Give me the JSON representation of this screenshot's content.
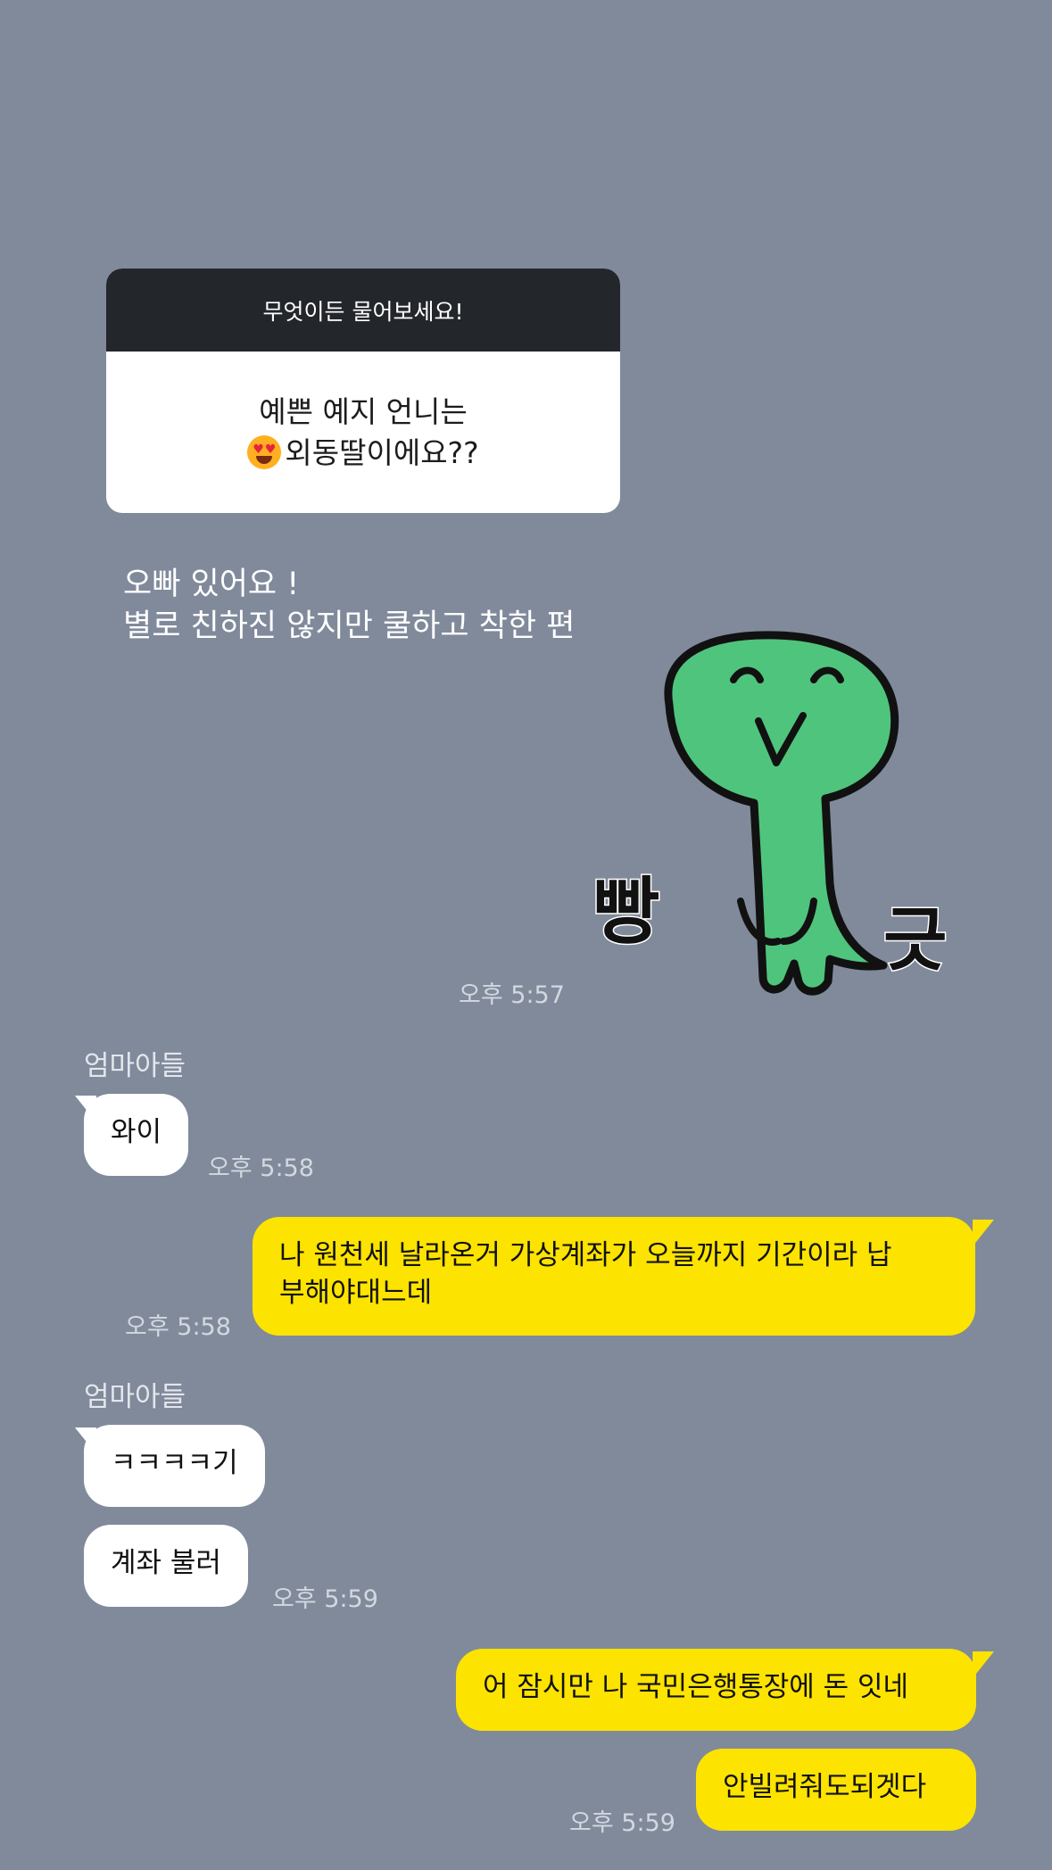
{
  "question_card": {
    "header": "무엇이든 물어보세요!",
    "line1": "예쁜 예지 언니는",
    "line2": "외동딸이에요??",
    "emoji": "heart-eyes-emoji"
  },
  "answer": {
    "line1": "오빠 있어요 !",
    "line2": "별로 친하진 않지만 쿨하고 착한 편"
  },
  "sticker": {
    "icon": "green-character-sticker",
    "text_left": "빵",
    "text_right": "긋",
    "color": "#4fc47d"
  },
  "messages": [
    {
      "time": "오후 5:57"
    },
    {
      "sender": "엄마아들",
      "text": "와이",
      "time": "오후 5:58"
    },
    {
      "line1": "나 원천세 날라온거 가상계좌가 오늘까지 기간이라 납",
      "line2": "부해야대느데",
      "time": "오후 5:58"
    },
    {
      "sender": "엄마아들",
      "text": "ㅋㅋㅋㅋ기"
    },
    {
      "text": "계좌 불러",
      "time": "오후 5:59"
    },
    {
      "text": "어 잠시만 나 국민은행통장에 돈 잇네"
    },
    {
      "text": "안빌려줘도되겟다",
      "time": "오후 5:59"
    }
  ],
  "colors": {
    "background": "#808a9b",
    "outgoing_bubble": "#fce300",
    "incoming_bubble": "#ffffff",
    "card_header": "#23262b"
  }
}
